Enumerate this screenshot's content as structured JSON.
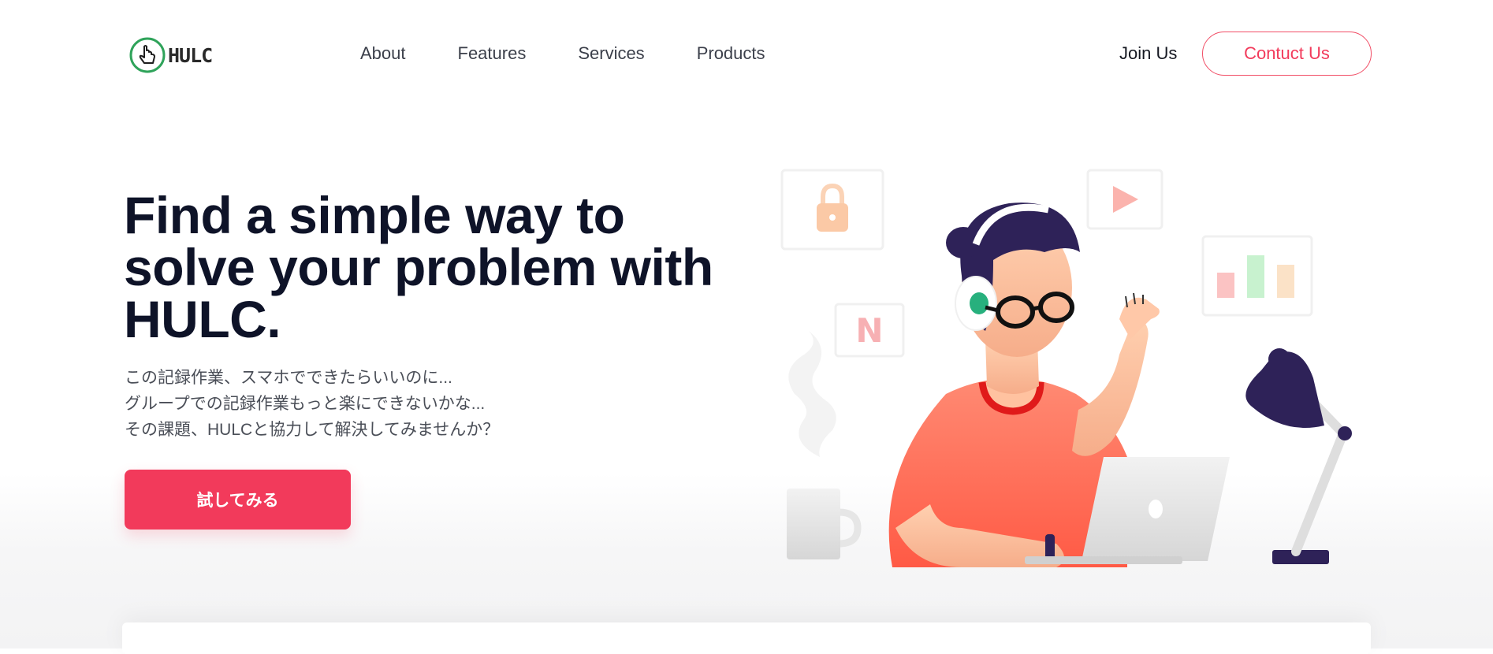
{
  "brand": {
    "name": "HULC"
  },
  "nav": {
    "links": [
      {
        "label": "About"
      },
      {
        "label": "Features"
      },
      {
        "label": "Services"
      },
      {
        "label": "Products"
      }
    ],
    "join_label": "Join Us",
    "contact_label": "Contuct Us"
  },
  "hero": {
    "title_lines": [
      "Find a simple way to",
      "solve your problem with",
      "HULC."
    ],
    "subtitle_lines": [
      "この記録作業、スマホでできたらいいのに...",
      "グループでの記録作業もっと楽にできないかな...",
      "その課題、HULCと協力して解決してみませんか？"
    ],
    "cta_label": "試してみる",
    "illustration_tile_letter": "N"
  },
  "colors": {
    "accent": "#f23a5b",
    "heading": "#0e1328",
    "text": "#4a4e57",
    "logo_ring": "#2fa35a",
    "character_hair": "#2e2258",
    "character_shirt": "#ff6b55"
  },
  "icons": [
    "cursor-hand-icon",
    "lock-icon",
    "play-icon",
    "bar-chart-icon",
    "netflix-n-icon",
    "lamp-icon",
    "mug-icon",
    "laptop-icon"
  ]
}
